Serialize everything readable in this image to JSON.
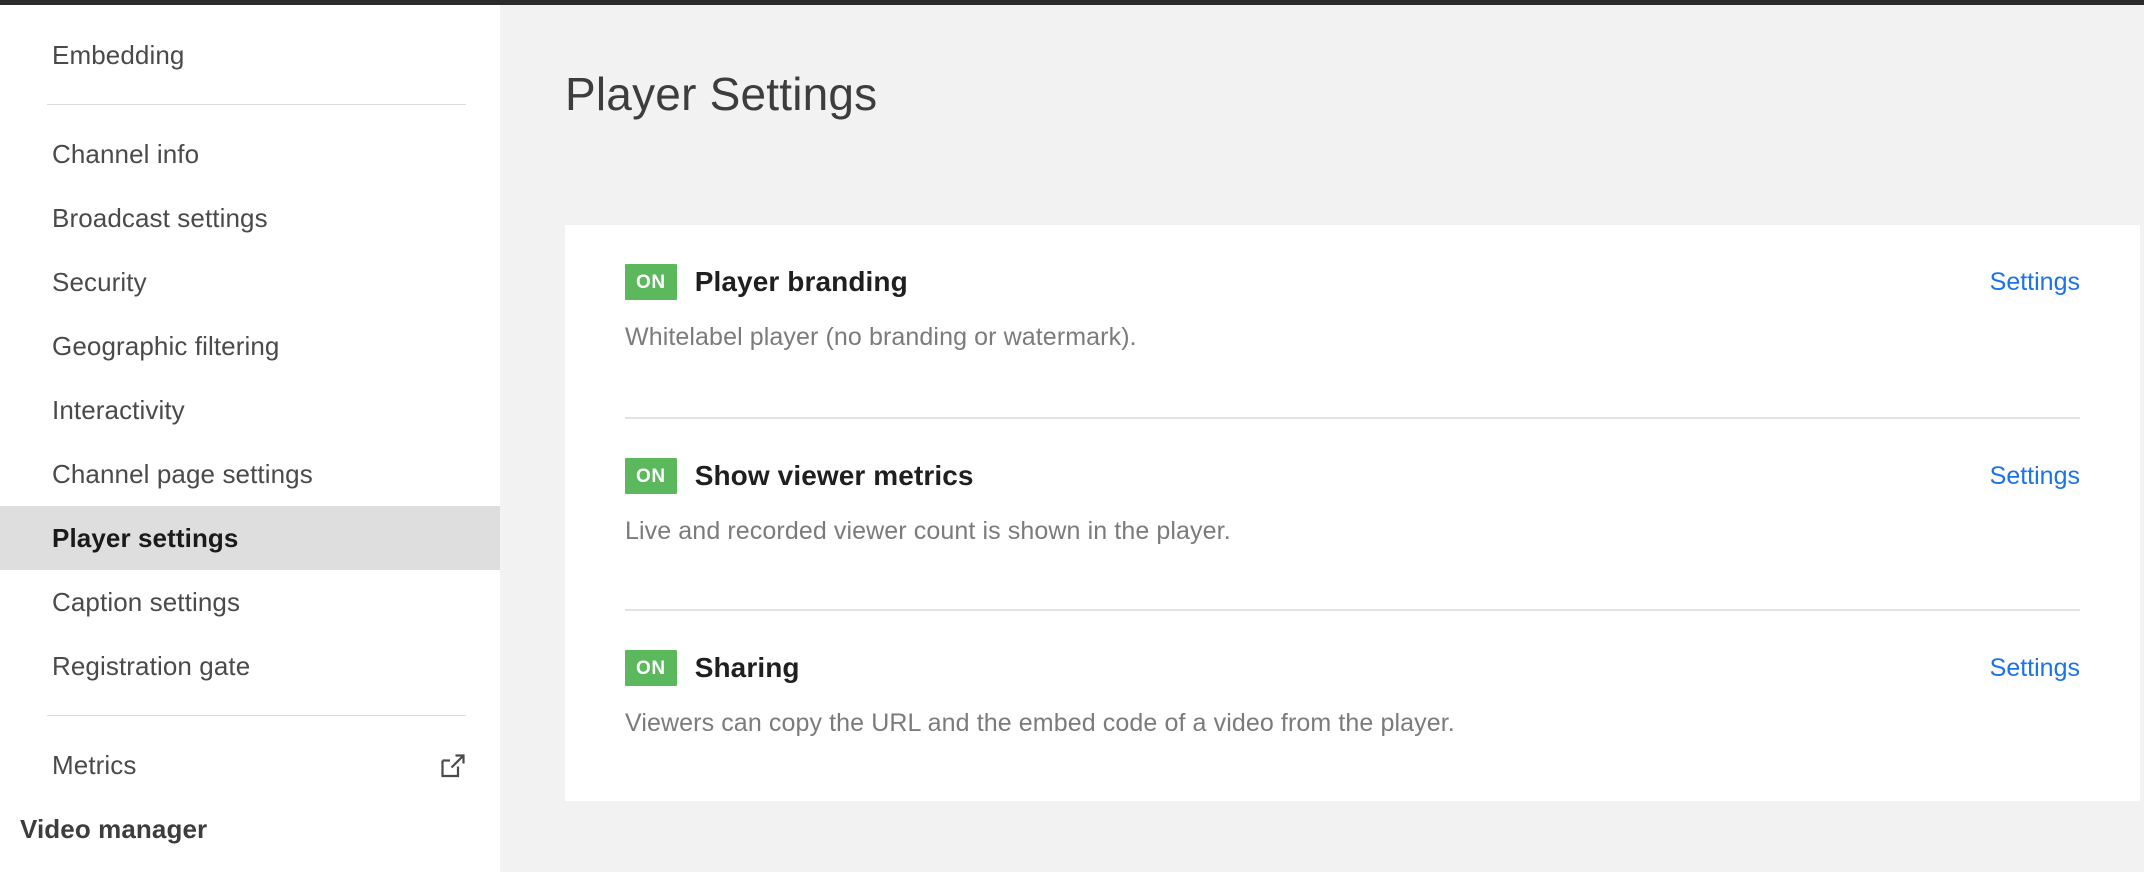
{
  "sidebar": {
    "groups": [
      {
        "items": [
          {
            "label": "Embedding",
            "style": "normal",
            "icon": null,
            "active": false
          }
        ]
      },
      {
        "items": [
          {
            "label": "Channel info",
            "style": "normal",
            "icon": null,
            "active": false
          },
          {
            "label": "Broadcast settings",
            "style": "normal",
            "icon": null,
            "active": false
          },
          {
            "label": "Security",
            "style": "normal",
            "icon": null,
            "active": false
          },
          {
            "label": "Geographic filtering",
            "style": "normal",
            "icon": null,
            "active": false
          },
          {
            "label": "Interactivity",
            "style": "normal",
            "icon": null,
            "active": false
          },
          {
            "label": "Channel page settings",
            "style": "normal",
            "icon": null,
            "active": false
          },
          {
            "label": "Player settings",
            "style": "normal",
            "icon": null,
            "active": true
          },
          {
            "label": "Caption settings",
            "style": "normal",
            "icon": null,
            "active": false
          },
          {
            "label": "Registration gate",
            "style": "normal",
            "icon": null,
            "active": false
          }
        ]
      },
      {
        "items": [
          {
            "label": "Metrics",
            "style": "normal",
            "icon": "external-link-icon",
            "active": false
          },
          {
            "label": "Video manager",
            "style": "strong",
            "icon": null,
            "active": false
          }
        ]
      }
    ]
  },
  "main": {
    "title": "Player Settings",
    "settings": [
      {
        "badge": "ON",
        "name": "Player branding",
        "description": "Whitelabel player (no branding or watermark).",
        "link": "Settings"
      },
      {
        "badge": "ON",
        "name": "Show viewer metrics",
        "description": "Live and recorded viewer count is shown in the player.",
        "link": "Settings"
      },
      {
        "badge": "ON",
        "name": "Sharing",
        "description": "Viewers can copy the URL and the embed code of a video from the player.",
        "link": "Settings"
      }
    ]
  },
  "colors": {
    "badge_on": "#5cb85c",
    "link": "#1a73e8",
    "active_row": "#dedede",
    "page_background": "#f2f2f2"
  }
}
